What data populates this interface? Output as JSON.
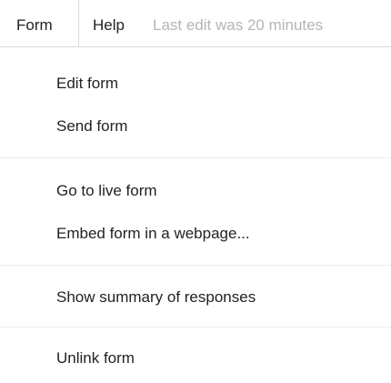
{
  "menubar": {
    "form_label": "Form",
    "help_label": "Help",
    "last_edit": "Last edit was 20 minutes"
  },
  "dropdown": {
    "items": [
      {
        "label": "Edit form"
      },
      {
        "label": "Send form"
      },
      {
        "label": "Go to live form"
      },
      {
        "label": "Embed form in a webpage..."
      },
      {
        "label": "Show summary of responses"
      },
      {
        "label": "Unlink form"
      }
    ]
  }
}
